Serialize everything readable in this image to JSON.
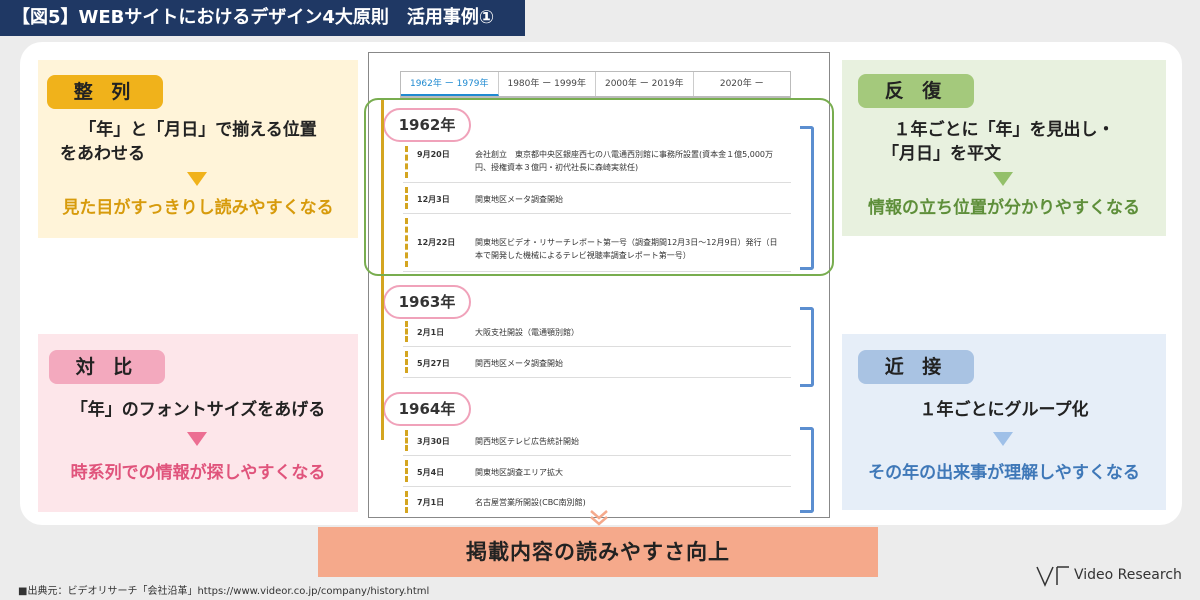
{
  "title": "【図5】WEBサイトにおけるデザイン4大原則　活用事例①",
  "principles": {
    "seiretsu": {
      "badge": "整 列",
      "line1": "「年」と「月日」で揃える位置",
      "line2": "をあわせる",
      "result": "見た目がすっきりし読みやすくなる",
      "accent": "#f0b21b"
    },
    "taihi": {
      "badge": "対 比",
      "line1": "「年」のフォントサイズをあげる",
      "result": "時系列での情報が探しやすくなる",
      "accent": "#f3a9be"
    },
    "hanpuku": {
      "badge": "反 復",
      "line1": "１年ごとに「年」を見出し・",
      "line2": "「月日」を平文",
      "result": "情報の立ち位置が分かりやすくなる",
      "accent": "#a4c97c"
    },
    "kinsetsu": {
      "badge": "近 接",
      "line1": "１年ごとにグループ化",
      "result": "その年の出来事が理解しやすくなる",
      "accent": "#a9c3e3"
    }
  },
  "history": {
    "tabs": [
      "1962年 ー 1979年",
      "1980年 ー 1999年",
      "2000年 ー 2019年",
      "2020年 ー"
    ],
    "years": [
      {
        "year": "1962年",
        "events": [
          {
            "date": "9月20日",
            "desc": "会社創立　東京都中央区銀座西七の八電通西別館に事務所設置(資本金１億5,000万円、授権資本３億円・初代社長に森崎実就任)"
          },
          {
            "date": "12月3日",
            "desc": "関東地区メータ調査開始"
          },
          {
            "date": "12月22日",
            "desc": "関東地区ビデオ・リサーチレポート第一号（調査期間12月3日～12月9日）発行（日本で開発した機械によるテレビ視聴率調査レポート第一号）"
          }
        ]
      },
      {
        "year": "1963年",
        "events": [
          {
            "date": "2月1日",
            "desc": "大阪支社開設（電通顎別館）"
          },
          {
            "date": "5月27日",
            "desc": "関西地区メータ調査開始"
          }
        ]
      },
      {
        "year": "1964年",
        "events": [
          {
            "date": "3月30日",
            "desc": "関西地区テレビ広告統計開始"
          },
          {
            "date": "5月4日",
            "desc": "関東地区調査エリア拡大"
          },
          {
            "date": "7月1日",
            "desc": "名古屋営業所開設(CBC南別館)"
          }
        ]
      }
    ]
  },
  "conclusion": "掲載内容の読みやすさ向上",
  "source": "■出典元：ビデオリサーチ「会社沿革」https://www.videor.co.jp/company/history.html",
  "logo": "Video Research"
}
